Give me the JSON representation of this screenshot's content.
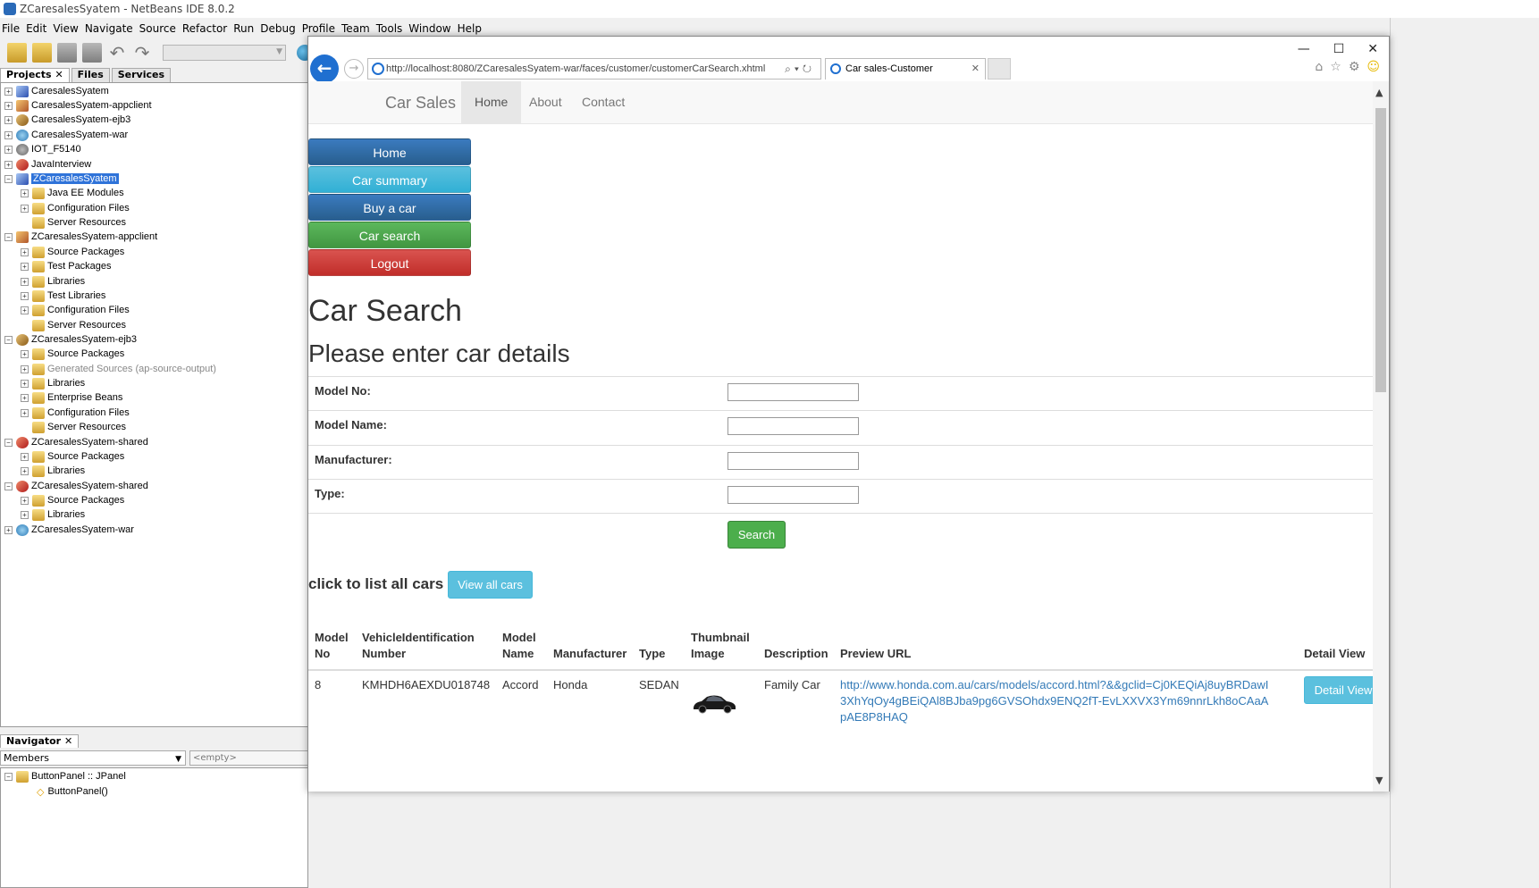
{
  "ide": {
    "title": "ZCaresalesSyatem - NetBeans IDE 8.0.2",
    "menu": [
      "File",
      "Edit",
      "View",
      "Navigate",
      "Source",
      "Refactor",
      "Run",
      "Debug",
      "Profile",
      "Team",
      "Tools",
      "Window",
      "Help"
    ],
    "panel_tabs": [
      "Projects",
      "Files",
      "Services"
    ],
    "tree": [
      {
        "label": "CaresalesSyatem",
        "icon": "ear-project-icon"
      },
      {
        "label": "CaresalesSyatem-appclient",
        "icon": "appclient-project-icon"
      },
      {
        "label": "CaresalesSyatem-ejb3",
        "icon": "ejb-project-icon"
      },
      {
        "label": "CaresalesSyatem-war",
        "icon": "web-project-icon"
      },
      {
        "label": "IOT_F5140",
        "icon": "globe-project-icon"
      },
      {
        "label": "JavaInterview",
        "icon": "java-project-icon"
      },
      {
        "label": "ZCaresalesSyatem",
        "icon": "ear-project-icon"
      },
      {
        "label": "Java EE Modules",
        "icon": "folder-icon"
      },
      {
        "label": "Configuration Files",
        "icon": "folder-icon"
      },
      {
        "label": "Server Resources",
        "icon": "folder-icon"
      },
      {
        "label": "ZCaresalesSyatem-appclient",
        "icon": "appclient-project-icon"
      },
      {
        "label": "Source Packages",
        "icon": "folder-icon"
      },
      {
        "label": "Test Packages",
        "icon": "folder-icon"
      },
      {
        "label": "Libraries",
        "icon": "folder-icon"
      },
      {
        "label": "Test Libraries",
        "icon": "folder-icon"
      },
      {
        "label": "Configuration Files",
        "icon": "folder-icon"
      },
      {
        "label": "Server Resources",
        "icon": "folder-icon"
      },
      {
        "label": "ZCaresalesSyatem-ejb3",
        "icon": "ejb-project-icon"
      },
      {
        "label": "Source Packages",
        "icon": "folder-icon"
      },
      {
        "label": "Generated Sources (ap-source-output)",
        "icon": "folder-icon"
      },
      {
        "label": "Libraries",
        "icon": "folder-icon"
      },
      {
        "label": "Enterprise Beans",
        "icon": "folder-icon"
      },
      {
        "label": "Configuration Files",
        "icon": "folder-icon"
      },
      {
        "label": "Server Resources",
        "icon": "folder-icon"
      },
      {
        "label": "ZCaresalesSyatem-shared",
        "icon": "java-project-icon"
      },
      {
        "label": "Source Packages",
        "icon": "folder-icon"
      },
      {
        "label": "Libraries",
        "icon": "folder-icon"
      },
      {
        "label": "ZCaresalesSyatem-shared",
        "icon": "java-project-icon"
      },
      {
        "label": "Source Packages",
        "icon": "folder-icon"
      },
      {
        "label": "Libraries",
        "icon": "folder-icon"
      },
      {
        "label": "ZCaresalesSyatem-war",
        "icon": "web-project-icon"
      }
    ],
    "navigator_tab": "Navigator",
    "navigator_members": "Members",
    "navigator_empty": "<empty>",
    "navigator_node": "ButtonPanel :: JPanel",
    "navigator_child": "ButtonPanel()"
  },
  "browser": {
    "url": "http://localhost:8080/ZCaresalesSyatem-war/faces/customer/customerCarSearch.xhtml",
    "tab_title": "Car sales-Customer"
  },
  "page": {
    "brand": "Car Sales",
    "nav": [
      "Home",
      "About",
      "Contact"
    ],
    "sidebar": [
      "Home",
      "Car summary",
      "Buy a car",
      "Car search",
      "Logout"
    ],
    "title": "Car Search",
    "subtitle": "Please enter car details",
    "fields": [
      {
        "label": "Model No:",
        "value": ""
      },
      {
        "label": "Model Name:",
        "value": ""
      },
      {
        "label": "Manufacturer:",
        "value": ""
      },
      {
        "label": "Type:",
        "value": ""
      }
    ],
    "search_button": "Search",
    "list_label": "click to list all cars :",
    "view_all_button": "View all cars",
    "table": {
      "headers": [
        "Model No",
        "VehicleIdentification Number",
        "Model Name",
        "Manufacturer",
        "Type",
        "Thumbnail Image",
        "Description",
        "Preview URL",
        "Detail View"
      ],
      "rows": [
        {
          "model_no": "8",
          "vin": "KMHDH6AEXDU018748",
          "model_name": "Accord",
          "manufacturer": "Honda",
          "type": "SEDAN",
          "thumbnail": "car-thumbnail-image",
          "description": "Family Car",
          "preview_url": "http://www.honda.com.au/cars/models/accord.html?&&gclid=Cj0KEQiAj8uyBRDawI3XhYqOy4gBEiQAl8BJba9pg6GVSOhdx9ENQ2fT-EvLXXVX3Ym69nnrLkh8oCAaApAE8P8HAQ",
          "detail_button": "Detail View"
        }
      ]
    }
  }
}
